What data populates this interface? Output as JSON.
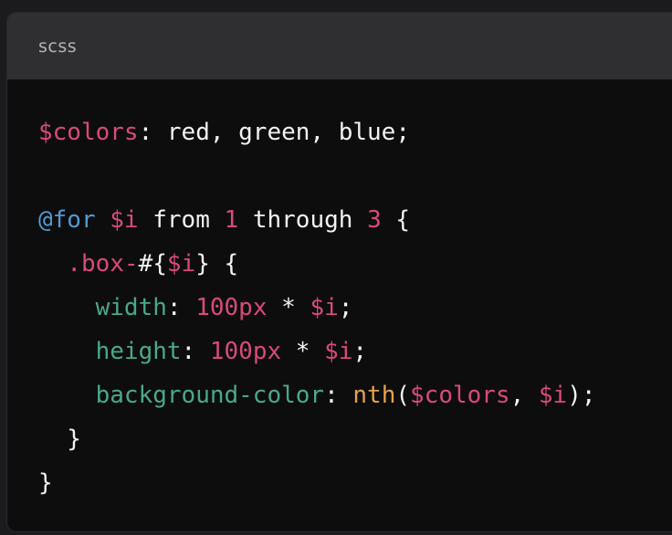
{
  "code_block": {
    "language": "scss",
    "lines": [
      [
        {
          "t": "$colors",
          "k": "var"
        },
        {
          "t": ": red, green, blue;",
          "k": "text"
        }
      ],
      [],
      [
        {
          "t": "@for",
          "k": "at"
        },
        {
          "t": " ",
          "k": "text"
        },
        {
          "t": "$i",
          "k": "var"
        },
        {
          "t": " from ",
          "k": "text"
        },
        {
          "t": "1",
          "k": "num"
        },
        {
          "t": " through ",
          "k": "text"
        },
        {
          "t": "3",
          "k": "num"
        },
        {
          "t": " {",
          "k": "text"
        }
      ],
      [
        {
          "t": "  ",
          "k": "text"
        },
        {
          "t": ".box-",
          "k": "sel"
        },
        {
          "t": "#{",
          "k": "text"
        },
        {
          "t": "$i",
          "k": "var"
        },
        {
          "t": "} {",
          "k": "text"
        }
      ],
      [
        {
          "t": "    ",
          "k": "text"
        },
        {
          "t": "width",
          "k": "prop"
        },
        {
          "t": ": ",
          "k": "text"
        },
        {
          "t": "100px",
          "k": "num"
        },
        {
          "t": " * ",
          "k": "text"
        },
        {
          "t": "$i",
          "k": "var"
        },
        {
          "t": ";",
          "k": "text"
        }
      ],
      [
        {
          "t": "    ",
          "k": "text"
        },
        {
          "t": "height",
          "k": "prop"
        },
        {
          "t": ": ",
          "k": "text"
        },
        {
          "t": "100px",
          "k": "num"
        },
        {
          "t": " * ",
          "k": "text"
        },
        {
          "t": "$i",
          "k": "var"
        },
        {
          "t": ";",
          "k": "text"
        }
      ],
      [
        {
          "t": "    ",
          "k": "text"
        },
        {
          "t": "background-color",
          "k": "prop"
        },
        {
          "t": ": ",
          "k": "text"
        },
        {
          "t": "nth",
          "k": "func"
        },
        {
          "t": "(",
          "k": "text"
        },
        {
          "t": "$colors",
          "k": "var"
        },
        {
          "t": ", ",
          "k": "text"
        },
        {
          "t": "$i",
          "k": "var"
        },
        {
          "t": ");",
          "k": "text"
        }
      ],
      [
        {
          "t": "  }",
          "k": "text"
        }
      ],
      [
        {
          "t": "}",
          "k": "text"
        }
      ]
    ]
  },
  "colors": {
    "page_background": "#1b1b1d",
    "header_background": "#2f2f31",
    "code_background": "#0d0d0d",
    "plain_text": "#f2f2f2",
    "variable": "#d84a78",
    "at_rule": "#4f9bd4",
    "property": "#4aa88a",
    "function": "#e5a24a"
  }
}
